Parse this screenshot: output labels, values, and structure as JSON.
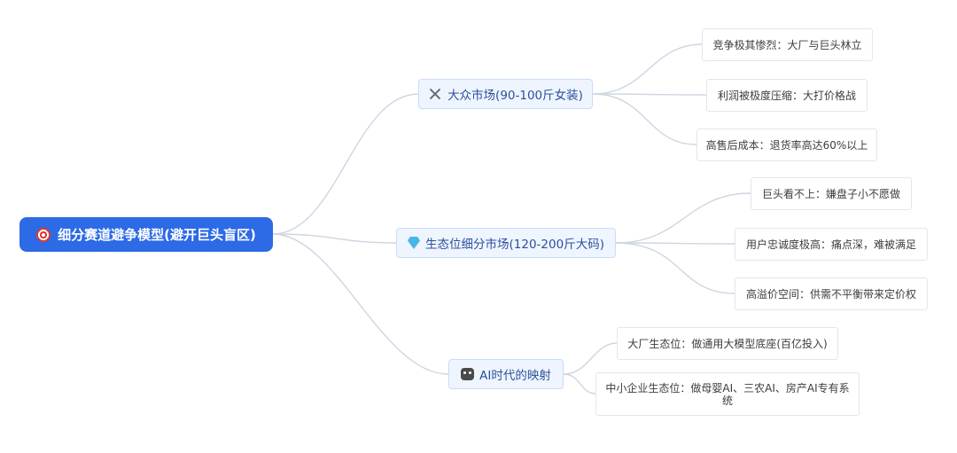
{
  "root": {
    "label": "细分赛道避争模型(避开巨头盲区)",
    "icon": "target-icon"
  },
  "branches": [
    {
      "label": "大众市场(90-100斤女装)",
      "icon": "crossed-swords-icon",
      "leaves": [
        "竞争极其惨烈：大厂与巨头林立",
        "利润被极度压缩：大打价格战",
        "高售后成本：退货率高达60%以上"
      ]
    },
    {
      "label": "生态位细分市场(120-200斤大码)",
      "icon": "gem-icon",
      "leaves": [
        "巨头看不上：嫌盘子小不愿做",
        "用户忠诚度极高：痛点深，难被满足",
        "高溢价空间：供需不平衡带来定价权"
      ]
    },
    {
      "label": "AI时代的映射",
      "icon": "robot-icon",
      "leaves": [
        "大厂生态位：做通用大模型底座(百亿投入)",
        "中小企业生态位：做母婴AI、三农AI、房产AI专有系统"
      ]
    }
  ],
  "colors": {
    "root_bg": "#2c6ae6",
    "branch_bg": "#eef5ff",
    "branch_text": "#2d4f9a",
    "connector": "#cfd6e2"
  }
}
